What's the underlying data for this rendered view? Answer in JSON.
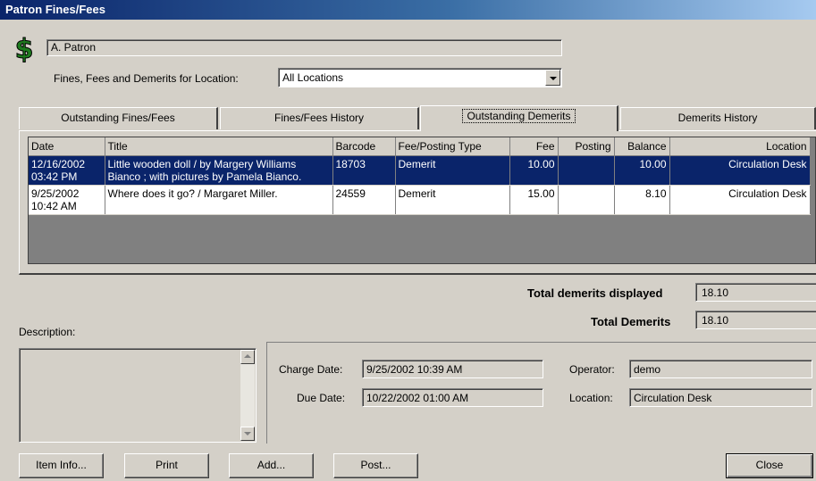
{
  "window": {
    "title": "Patron Fines/Fees"
  },
  "patron": {
    "name": "A. Patron",
    "icon": "dollar-icon"
  },
  "location_filter": {
    "label": "Fines, Fees and Demerits for Location:",
    "value": "All Locations"
  },
  "tabs": [
    {
      "label": "Outstanding Fines/Fees",
      "active": false
    },
    {
      "label": "Fines/Fees History",
      "active": false
    },
    {
      "label": "Outstanding Demerits",
      "active": true
    },
    {
      "label": "Demerits History",
      "active": false
    }
  ],
  "grid": {
    "columns": [
      "Date",
      "Title",
      "Barcode",
      "Fee/Posting Type",
      "Fee",
      "Posting",
      "Balance",
      "Location"
    ],
    "rows": [
      {
        "date": "12/16/2002 03:42 PM",
        "title": "Little wooden doll / by Margery Williams Bianco ; with pictures by Pamela Bianco.",
        "barcode": "18703",
        "type": "Demerit",
        "fee": "10.00",
        "posting": "",
        "balance": "10.00",
        "location": "Circulation Desk",
        "selected": true
      },
      {
        "date": "9/25/2002 10:42 AM",
        "title": "Where does it go? / Margaret Miller.",
        "barcode": "24559",
        "type": "Demerit",
        "fee": "15.00",
        "posting": "",
        "balance": "8.10",
        "location": "Circulation Desk",
        "selected": false
      }
    ]
  },
  "totals": {
    "displayed_label": "Total demerits displayed",
    "displayed_value": "18.10",
    "total_label": "Total Demerits",
    "total_value": "18.10"
  },
  "description": {
    "label": "Description:",
    "value": ""
  },
  "details": {
    "charge_date_label": "Charge Date:",
    "charge_date": "9/25/2002 10:39 AM",
    "due_date_label": "Due Date:",
    "due_date": "10/22/2002 01:00 AM",
    "operator_label": "Operator:",
    "operator": "demo",
    "location_label": "Location:",
    "location": "Circulation Desk"
  },
  "buttons": {
    "item_info": "Item Info...",
    "print": "Print",
    "add": "Add...",
    "post": "Post...",
    "close": "Close"
  },
  "colors": {
    "selection": "#0a246a",
    "face": "#d4d0c8",
    "dollar": "#1e7a1e"
  }
}
